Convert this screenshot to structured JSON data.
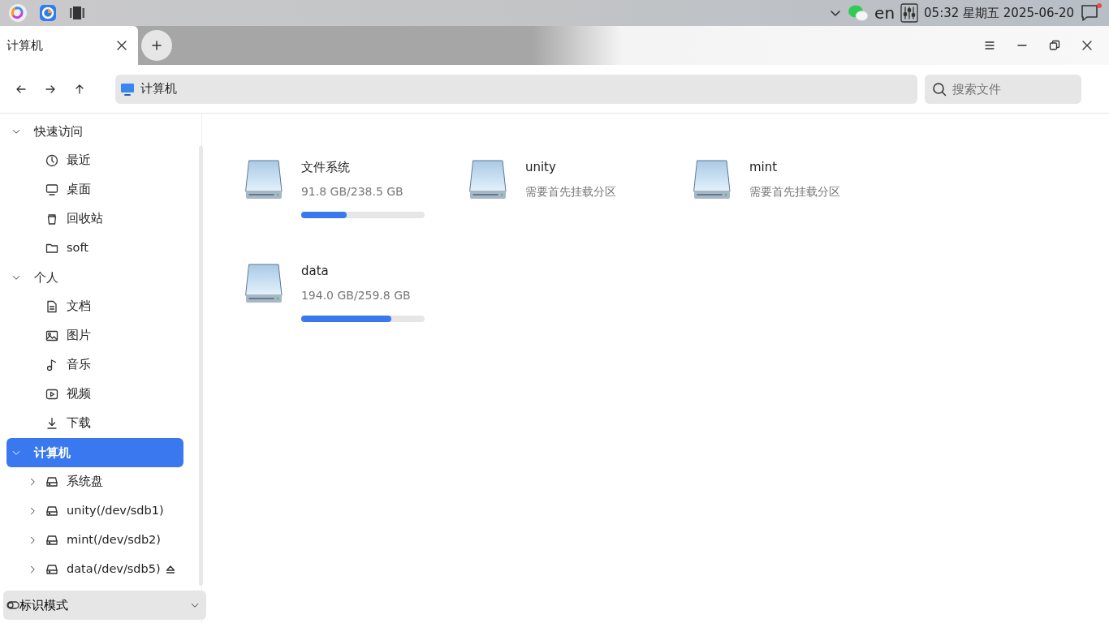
{
  "top_panel": {
    "indicators": [
      {
        "text": "en"
      }
    ],
    "clock": "05:32 星期五 2025-06-20",
    "notification_unread": true
  },
  "tabs": [
    {
      "label": "计算机",
      "selected": true
    }
  ],
  "address_bar": {
    "path": "计算机"
  },
  "search": {
    "placeholder": "搜索文件"
  },
  "sidebar": {
    "groups": [
      {
        "label": "快速访问",
        "expanded": true,
        "selected": false,
        "children": [
          {
            "label": "最近"
          },
          {
            "label": "桌面"
          },
          {
            "label": "回收站"
          },
          {
            "label": "soft"
          }
        ]
      },
      {
        "label": "个人",
        "expanded": true,
        "selected": false,
        "children": [
          {
            "label": "文档"
          },
          {
            "label": "图片"
          },
          {
            "label": "音乐"
          },
          {
            "label": "视频"
          },
          {
            "label": "下载"
          }
        ]
      },
      {
        "label": "计算机",
        "expanded": true,
        "selected": true,
        "children": [
          {
            "label": "系统盘",
            "expanded": false,
            "ejectable": false
          },
          {
            "label": "unity(/dev/sdb1)",
            "expanded": false,
            "ejectable": false
          },
          {
            "label": "mint(/dev/sdb2)",
            "expanded": false,
            "ejectable": false
          },
          {
            "label": "data(/dev/sdb5)",
            "expanded": false,
            "ejectable": true
          }
        ]
      }
    ]
  },
  "mode_dropdown": {
    "label": "标识模式"
  },
  "drives": [
    {
      "name": "文件系统",
      "detail": "91.8 GB/238.5 GB",
      "level": 0.37
    },
    {
      "name": "unity",
      "detail": "需要首先挂载分区"
    },
    {
      "name": "mint",
      "detail": "需要首先挂载分区"
    },
    {
      "name": "data",
      "detail": "194.0 GB/259.8 GB",
      "level": 0.73
    }
  ]
}
